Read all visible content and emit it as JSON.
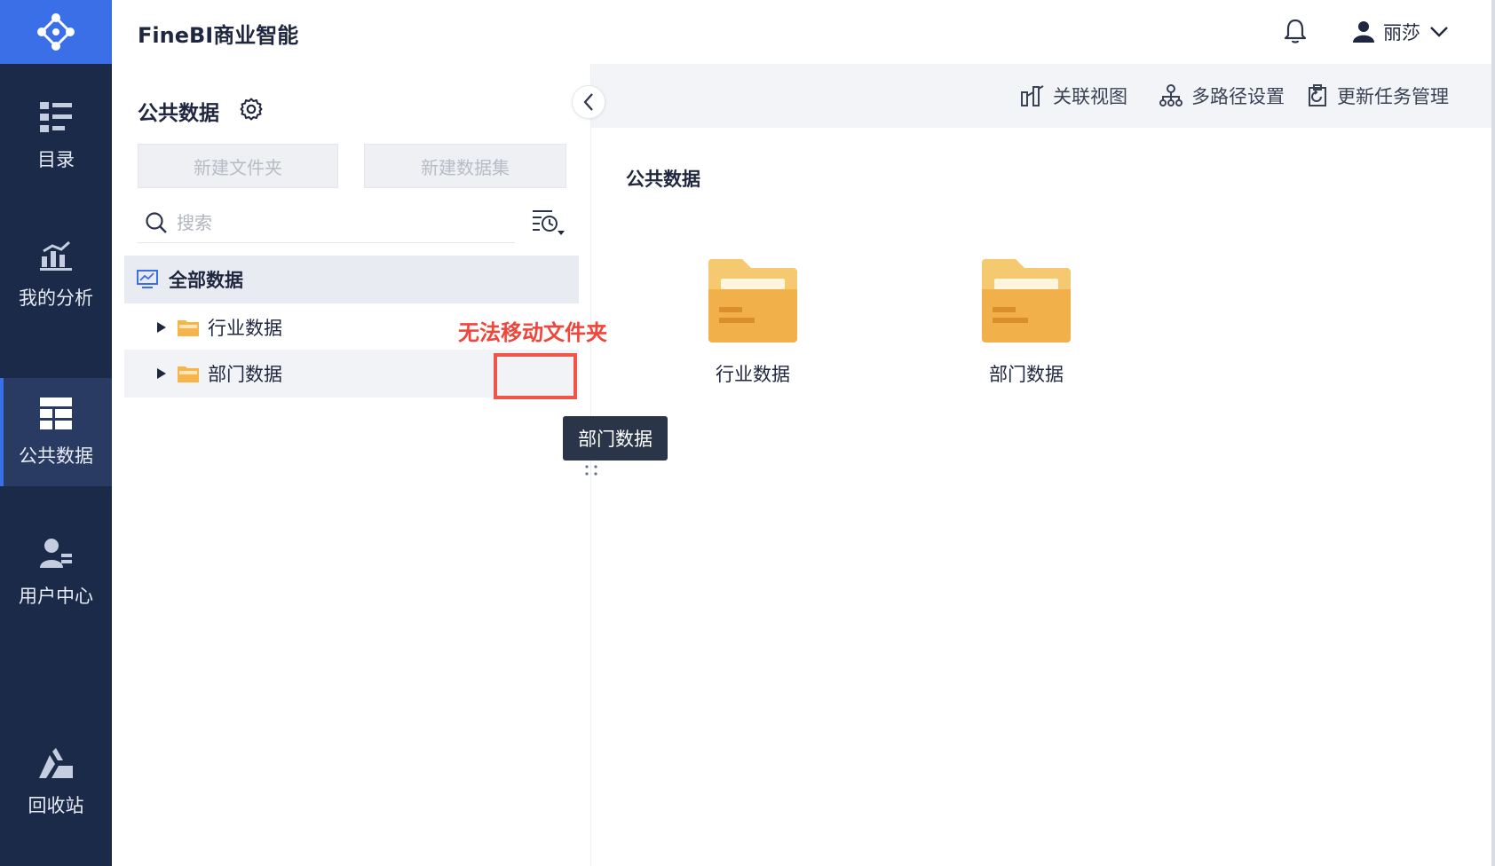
{
  "app": {
    "title": "FineBI商业智能"
  },
  "header": {
    "user_name": "丽莎"
  },
  "nav": {
    "items": [
      {
        "label": "目录",
        "icon": "catalog-icon"
      },
      {
        "label": "我的分析",
        "icon": "analysis-icon"
      },
      {
        "label": "公共数据",
        "icon": "public-data-icon",
        "active": true
      },
      {
        "label": "用户中心",
        "icon": "user-center-icon"
      },
      {
        "label": "回收站",
        "icon": "recycle-bin-icon"
      }
    ]
  },
  "left_panel": {
    "title": "公共数据",
    "new_folder_label": "新建文件夹",
    "new_dataset_label": "新建数据集",
    "search_placeholder": "搜索",
    "tree": {
      "root_label": "全部数据",
      "folders": [
        {
          "label": "行业数据"
        },
        {
          "label": "部门数据"
        }
      ]
    }
  },
  "annotation": {
    "text": "无法移动文件夹"
  },
  "tooltip": {
    "text": "部门数据"
  },
  "toolbar": {
    "relation_view_label": "关联视图",
    "multipath_label": "多路径设置",
    "update_task_label": "更新任务管理"
  },
  "main": {
    "title": "公共数据",
    "items": [
      {
        "label": "行业数据"
      },
      {
        "label": "部门数据"
      }
    ]
  },
  "colors": {
    "rail_bg": "#1c2a4a",
    "brand_blue": "#3a6fe8",
    "folder_yellow": "#f5b54b",
    "annotation_red": "#f0453a"
  }
}
